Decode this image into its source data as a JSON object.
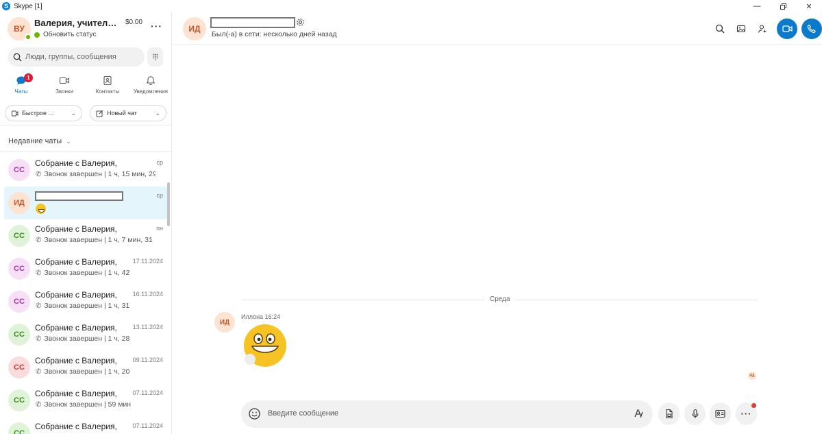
{
  "window": {
    "title": "Skype [1]"
  },
  "profile": {
    "initials": "ВУ",
    "name": "Валерия, учитель м...",
    "balance": "$0.00",
    "status": "Обновить статус"
  },
  "search": {
    "placeholder": "Люди, группы, сообщения"
  },
  "nav": {
    "chats": "Чаты",
    "calls": "Звонки",
    "contacts": "Контакты",
    "notifications": "Уведомления",
    "chats_badge": "1"
  },
  "actions": {
    "quick": "Быстрое ...",
    "new_chat": "Новый чат"
  },
  "recent": {
    "title": "Недавние чаты"
  },
  "chats": [
    {
      "initials": "СС",
      "name": "Собрание с Валерия,",
      "date": "ср",
      "sub": "Звонок завершен | 1 ч, 15 мин, 29"
    },
    {
      "initials": "ИД",
      "name": "",
      "date": "ср",
      "sub": ""
    },
    {
      "initials": "СС",
      "name": "Собрание с Валерия,",
      "date": "пн",
      "sub": "Звонок завершен | 1 ч, 7 мин, 31"
    },
    {
      "initials": "СС",
      "name": "Собрание с Валерия,",
      "date": "17.11.2024",
      "sub": "Звонок завершен | 1 ч, 42"
    },
    {
      "initials": "СС",
      "name": "Собрание с Валерия,",
      "date": "16.11.2024",
      "sub": "Звонок завершен | 1 ч, 31"
    },
    {
      "initials": "СС",
      "name": "Собрание с Валерия,",
      "date": "13.11.2024",
      "sub": "Звонок завершен | 1 ч, 28"
    },
    {
      "initials": "СС",
      "name": "Собрание с Валерия,",
      "date": "09.11.2024",
      "sub": "Звонок завершен | 1 ч, 20"
    },
    {
      "initials": "СС",
      "name": "Собрание с Валерия,",
      "date": "07.11.2024",
      "sub": "Звонок завершен | 59 мин"
    },
    {
      "initials": "СС",
      "name": "Собрание с Валерия,",
      "date": "07.11.2024",
      "sub": ""
    }
  ],
  "conversation": {
    "initials": "ИД",
    "status": "Был(-а) в сети: несколько дней назад",
    "day_label": "Среда",
    "message": {
      "sender_initials": "ИД",
      "meta": "Иллона 16:24"
    },
    "read_receipt": "ИД"
  },
  "composer": {
    "placeholder": "Введите сообщение"
  },
  "colors": {
    "accent": "#0a7acc",
    "badge": "#d91a32",
    "selected_row": "#e5f5fc"
  }
}
